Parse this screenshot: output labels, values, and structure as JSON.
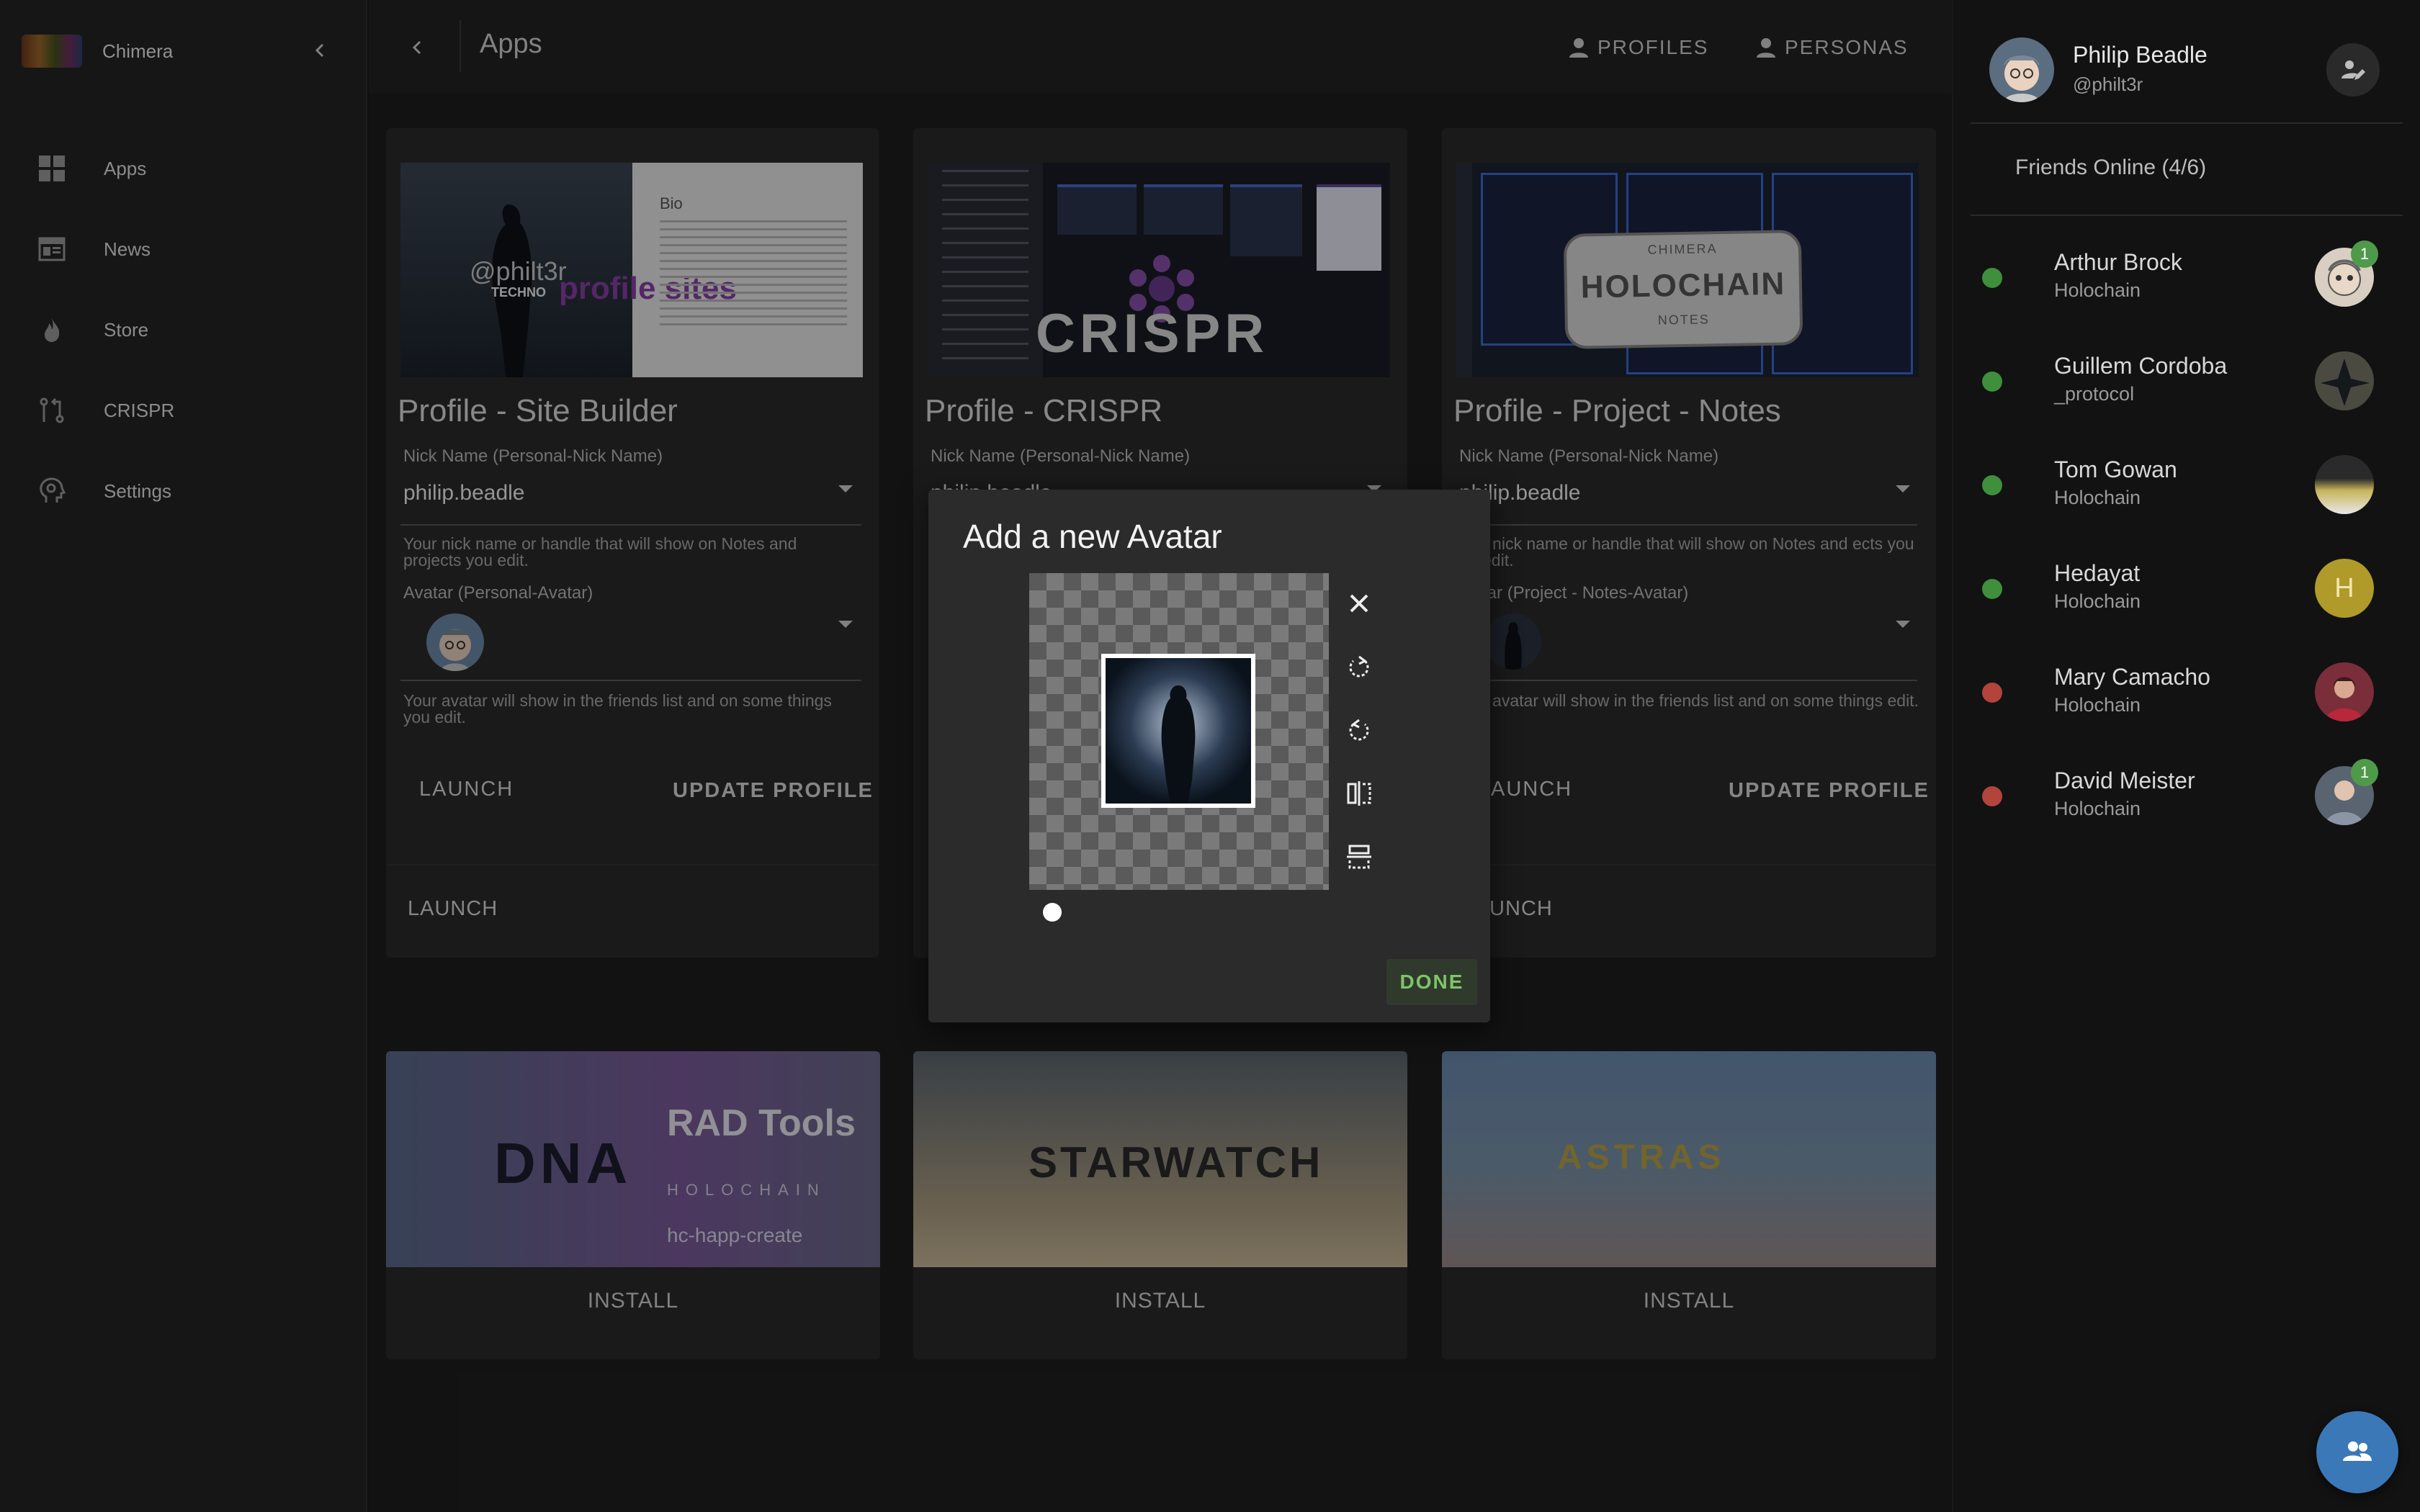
{
  "app": {
    "name": "Chimera",
    "collapse_icon": "chevron-left-icon"
  },
  "sidebar": {
    "items": [
      {
        "label": "Apps",
        "icon": "grid-icon"
      },
      {
        "label": "News",
        "icon": "newspaper-icon"
      },
      {
        "label": "Store",
        "icon": "fire-icon"
      },
      {
        "label": "CRISPR",
        "icon": "git-compare-icon"
      },
      {
        "label": "Settings",
        "icon": "head-gear-icon"
      }
    ]
  },
  "topbar": {
    "title": "Apps",
    "profiles_label": "PROFILES",
    "personas_label": "PERSONAS"
  },
  "cards": [
    {
      "title": "Profile - Site Builder",
      "image_text": {
        "handle": "@philt3r",
        "techno": "TECHNO",
        "headline": "profile sites",
        "bio": "Bio"
      },
      "nick_label": "Nick Name (Personal-Nick Name)",
      "nick_value": "philip.beadle",
      "nick_helper": "Your nick name or handle that will show on Notes and projects you edit.",
      "avatar_label": "Avatar (Personal-Avatar)",
      "avatar_helper": "Your avatar will show in the friends list and on some things you edit.",
      "launch": "LAUNCH",
      "update": "UPDATE PROFILE",
      "footer_launch": "LAUNCH"
    },
    {
      "title": "Profile - CRISPR",
      "image_text": {
        "logo": "CRISPR"
      },
      "nick_label": "Nick Name (Personal-Nick Name)",
      "nick_value": "philip.beadle"
    },
    {
      "title": "Profile - Project - Notes",
      "image_text": {
        "top": "CHIMERA",
        "main": "HOLOCHAIN",
        "bottom": "NOTES"
      },
      "nick_label": "Nick Name (Personal-Nick Name)",
      "nick_value": "philip.beadle",
      "nick_helper": "r nick name or handle that will show on Notes and ects you edit.",
      "avatar_label": "tar (Project - Notes-Avatar)",
      "avatar_helper": "r avatar will show in the friends list and on some things edit.",
      "launch": "AUNCH",
      "update": "UPDATE PROFILE",
      "footer_launch": "UNCH"
    }
  ],
  "install_cards": [
    {
      "label": "INSTALL",
      "image_text": {
        "title": "RAD Tools",
        "sub": "HOLOCHAIN",
        "cmd": "hc-happ-create",
        "bg": "DNA"
      }
    },
    {
      "label": "INSTALL",
      "image_text": {
        "title": "STARWATCH"
      }
    },
    {
      "label": "INSTALL",
      "image_text": {
        "title": "ASTRAS"
      }
    }
  ],
  "dialog": {
    "title": "Add a new Avatar",
    "done": "DONE",
    "tools": [
      "close-icon",
      "rotate-right-icon",
      "rotate-left-icon",
      "flip-horizontal-icon",
      "flip-vertical-icon"
    ]
  },
  "user": {
    "name": "Philip Beadle",
    "handle": "@philt3r"
  },
  "friends": {
    "header": "Friends Online (4/6)",
    "list": [
      {
        "name": "Arthur Brock",
        "sub": "Holochain",
        "status": "online",
        "badge": "1"
      },
      {
        "name": "Guillem Cordoba",
        "sub": "_protocol",
        "status": "online"
      },
      {
        "name": "Tom Gowan",
        "sub": "Holochain",
        "status": "online"
      },
      {
        "name": "Hedayat",
        "sub": "Holochain",
        "status": "online",
        "initial": "H"
      },
      {
        "name": "Mary Camacho",
        "sub": "Holochain",
        "status": "offline"
      },
      {
        "name": "David Meister",
        "sub": "Holochain",
        "status": "offline",
        "badge": "1"
      }
    ]
  },
  "colors": {
    "online": "#3f8f3c",
    "offline": "#b2443b",
    "accent": "#3b78b8",
    "done": "#7fc36a"
  }
}
